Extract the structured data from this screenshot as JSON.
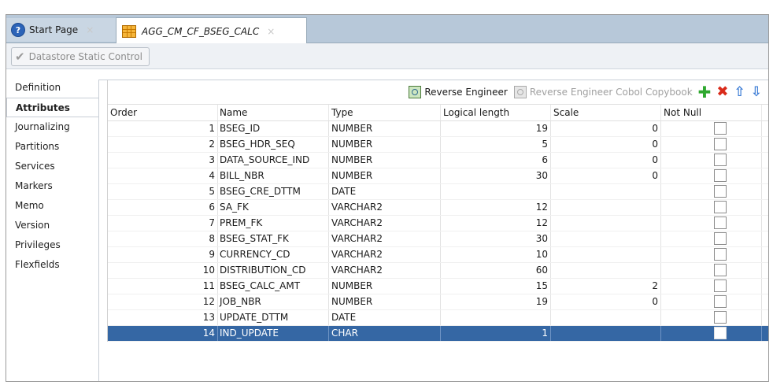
{
  "tabs": [
    {
      "label": "Start Page",
      "icon": "help-icon",
      "close": "×"
    },
    {
      "label": "AGG_CM_CF_BSEG_CALC",
      "icon": "datastore-grid-icon",
      "close": "×"
    }
  ],
  "toolbar": {
    "datastore_static_control": "Datastore Static Control"
  },
  "nav": {
    "items": [
      "Definition",
      "Attributes",
      "Journalizing",
      "Partitions",
      "Services",
      "Markers",
      "Memo",
      "Version",
      "Privileges",
      "Flexfields"
    ],
    "active": "Attributes"
  },
  "panel_toolbar": {
    "reverse_engineer": "Reverse Engineer",
    "reverse_engineer_cobol": "Reverse Engineer Cobol Copybook",
    "add_icon": "✚",
    "delete_icon": "✖",
    "up_icon": "⇧",
    "down_icon": "⇩"
  },
  "table": {
    "headers": [
      "Order",
      "Name",
      "Type",
      "Logical length",
      "Scale",
      "Not Null"
    ],
    "rows": [
      {
        "order": "1",
        "name": "BSEG_ID",
        "type": "NUMBER",
        "length": "19",
        "scale": "0",
        "not_null": false
      },
      {
        "order": "2",
        "name": "BSEG_HDR_SEQ",
        "type": "NUMBER",
        "length": "5",
        "scale": "0",
        "not_null": false
      },
      {
        "order": "3",
        "name": "DATA_SOURCE_IND",
        "type": "NUMBER",
        "length": "6",
        "scale": "0",
        "not_null": false
      },
      {
        "order": "4",
        "name": "BILL_NBR",
        "type": "NUMBER",
        "length": "30",
        "scale": "0",
        "not_null": false
      },
      {
        "order": "5",
        "name": "BSEG_CRE_DTTM",
        "type": "DATE",
        "length": "",
        "scale": "",
        "not_null": false
      },
      {
        "order": "6",
        "name": "SA_FK",
        "type": "VARCHAR2",
        "length": "12",
        "scale": "",
        "not_null": false
      },
      {
        "order": "7",
        "name": "PREM_FK",
        "type": "VARCHAR2",
        "length": "12",
        "scale": "",
        "not_null": false
      },
      {
        "order": "8",
        "name": "BSEG_STAT_FK",
        "type": "VARCHAR2",
        "length": "30",
        "scale": "",
        "not_null": false
      },
      {
        "order": "9",
        "name": "CURRENCY_CD",
        "type": "VARCHAR2",
        "length": "10",
        "scale": "",
        "not_null": false
      },
      {
        "order": "10",
        "name": "DISTRIBUTION_CD",
        "type": "VARCHAR2",
        "length": "60",
        "scale": "",
        "not_null": false
      },
      {
        "order": "11",
        "name": "BSEG_CALC_AMT",
        "type": "NUMBER",
        "length": "15",
        "scale": "2",
        "not_null": false
      },
      {
        "order": "12",
        "name": "JOB_NBR",
        "type": "NUMBER",
        "length": "19",
        "scale": "0",
        "not_null": false
      },
      {
        "order": "13",
        "name": "UPDATE_DTTM",
        "type": "DATE",
        "length": "",
        "scale": "",
        "not_null": false
      },
      {
        "order": "14",
        "name": "IND_UPDATE",
        "type": "CHAR",
        "length": "1",
        "scale": "",
        "not_null": false
      }
    ],
    "selected_row": 14
  }
}
